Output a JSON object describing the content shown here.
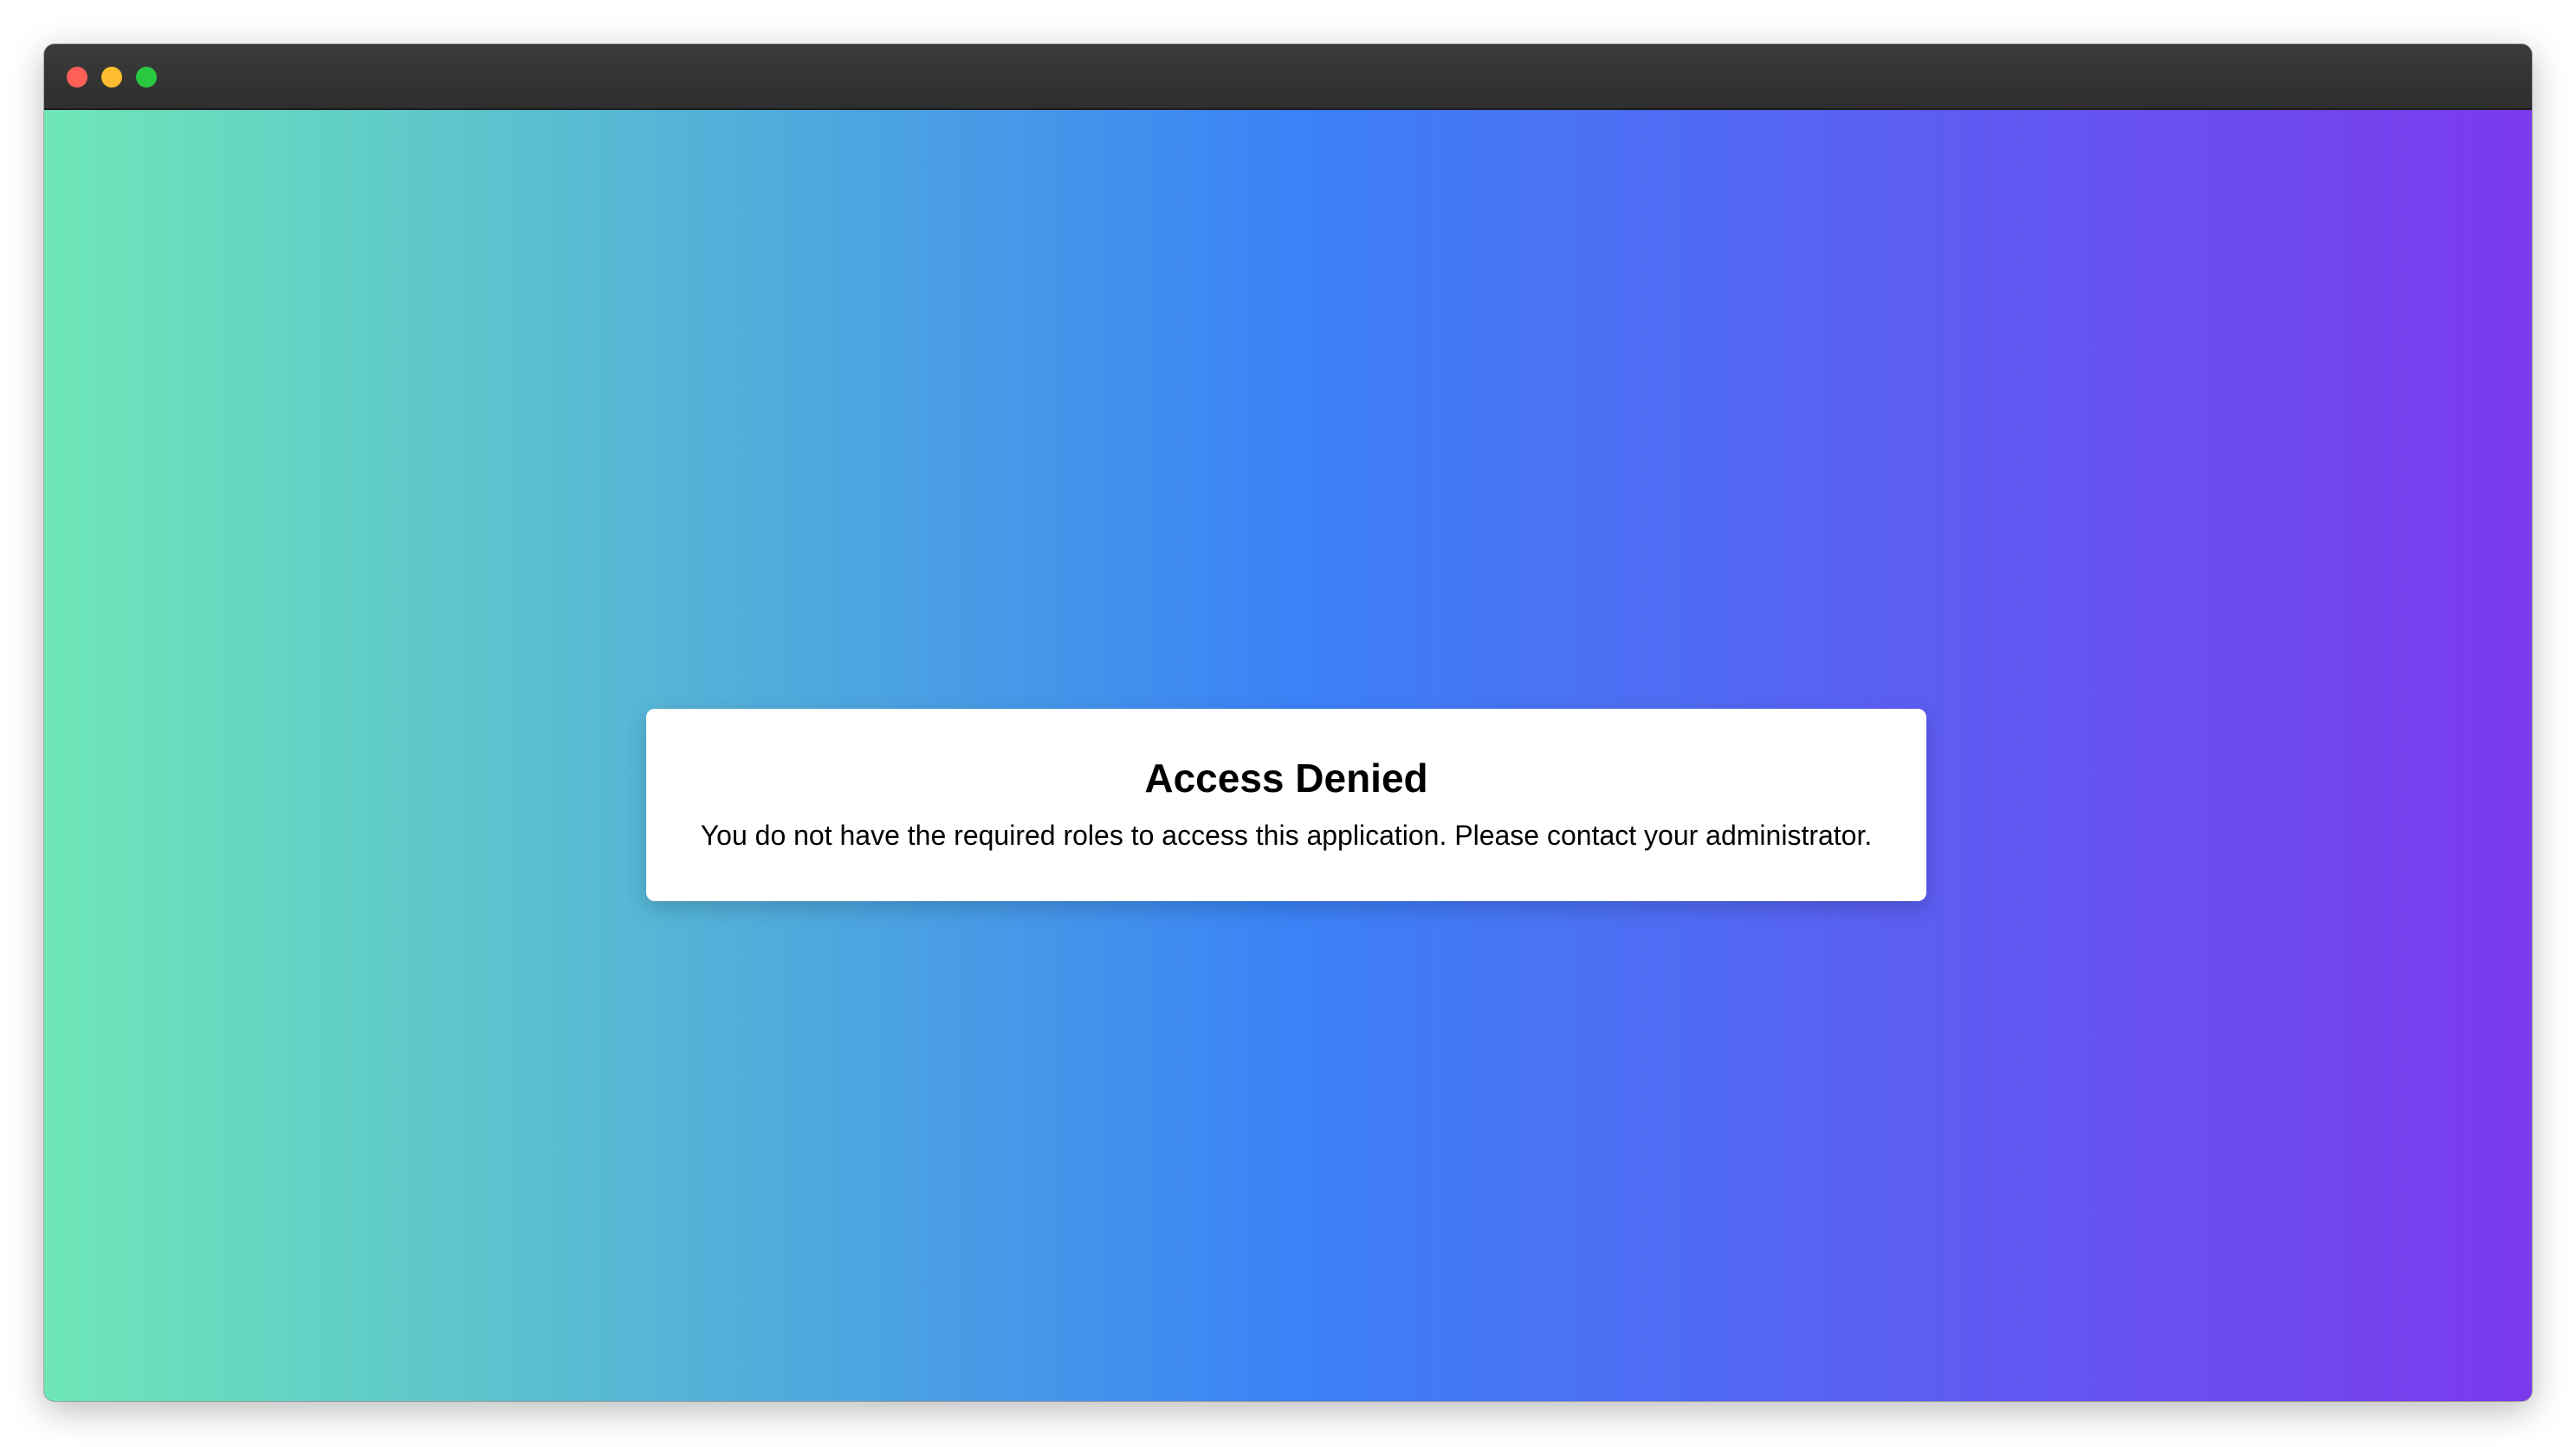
{
  "window": {
    "controls": [
      {
        "name": "close",
        "color": "#fe5f57"
      },
      {
        "name": "minimize",
        "color": "#febc2e"
      },
      {
        "name": "maximize",
        "color": "#28c840"
      }
    ]
  },
  "background": {
    "gradient_colors": [
      "#6ee7b7",
      "#3b82f6",
      "#7c3aed"
    ]
  },
  "dialog": {
    "title": "Access Denied",
    "message": "You do not have the required roles to access this application. Please contact your administrator."
  }
}
